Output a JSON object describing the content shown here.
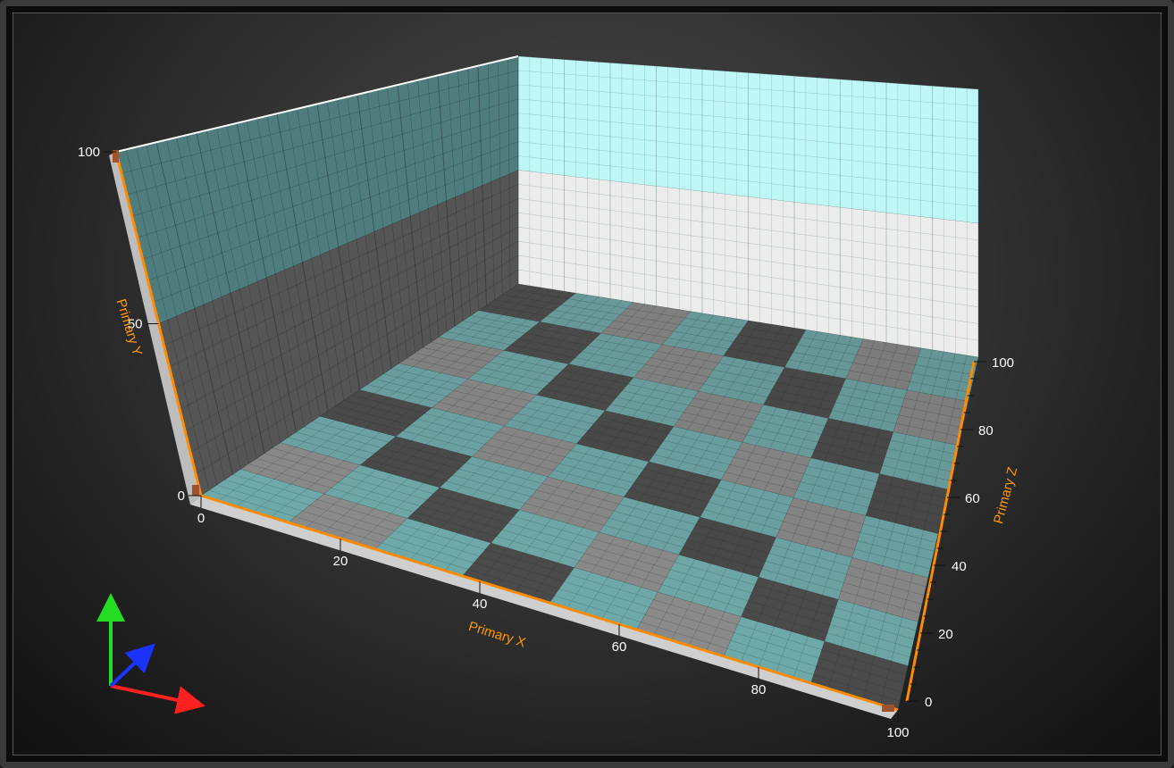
{
  "chart_data": {
    "type": "surface-3d",
    "x_axis": {
      "title": "Primary X",
      "range": [
        0,
        100
      ],
      "ticks": [
        0,
        20,
        40,
        60,
        80,
        100
      ],
      "tick_labels": [
        "0",
        "20",
        "40",
        "60",
        "80",
        "100"
      ]
    },
    "y_axis": {
      "title": "Primary Y",
      "range": [
        0,
        100
      ],
      "ticks": [
        0,
        50,
        100
      ],
      "tick_labels": [
        "0",
        "50",
        "100"
      ]
    },
    "z_axis": {
      "title": "Primary Z",
      "range": [
        0,
        100
      ],
      "ticks": [
        0,
        20,
        40,
        60,
        80,
        100
      ],
      "tick_labels": [
        "0",
        "20",
        "40",
        "60",
        "80",
        "100"
      ]
    },
    "floor_bands": {
      "x_step": 12.5,
      "z_step": 12.5,
      "pattern": "checkerboard"
    },
    "wall_bands": {
      "y_edges": [
        50,
        100
      ]
    },
    "colors": {
      "axis": "#ff8c00",
      "axis_title": "#ff9900",
      "band_teal": "#6fa8a8",
      "band_gray_light": "#8a8a8a",
      "band_gray_dark": "#4a4a4a",
      "back_wall_top": "#bff7f7",
      "back_wall_bottom": "#ececec",
      "side_wall_top": "#4f7d7d",
      "side_wall_bottom": "#555555"
    },
    "orientation_gizmo": {
      "x_color": "#ff2020",
      "y_color": "#22dd22",
      "z_color": "#1a33ff"
    }
  }
}
